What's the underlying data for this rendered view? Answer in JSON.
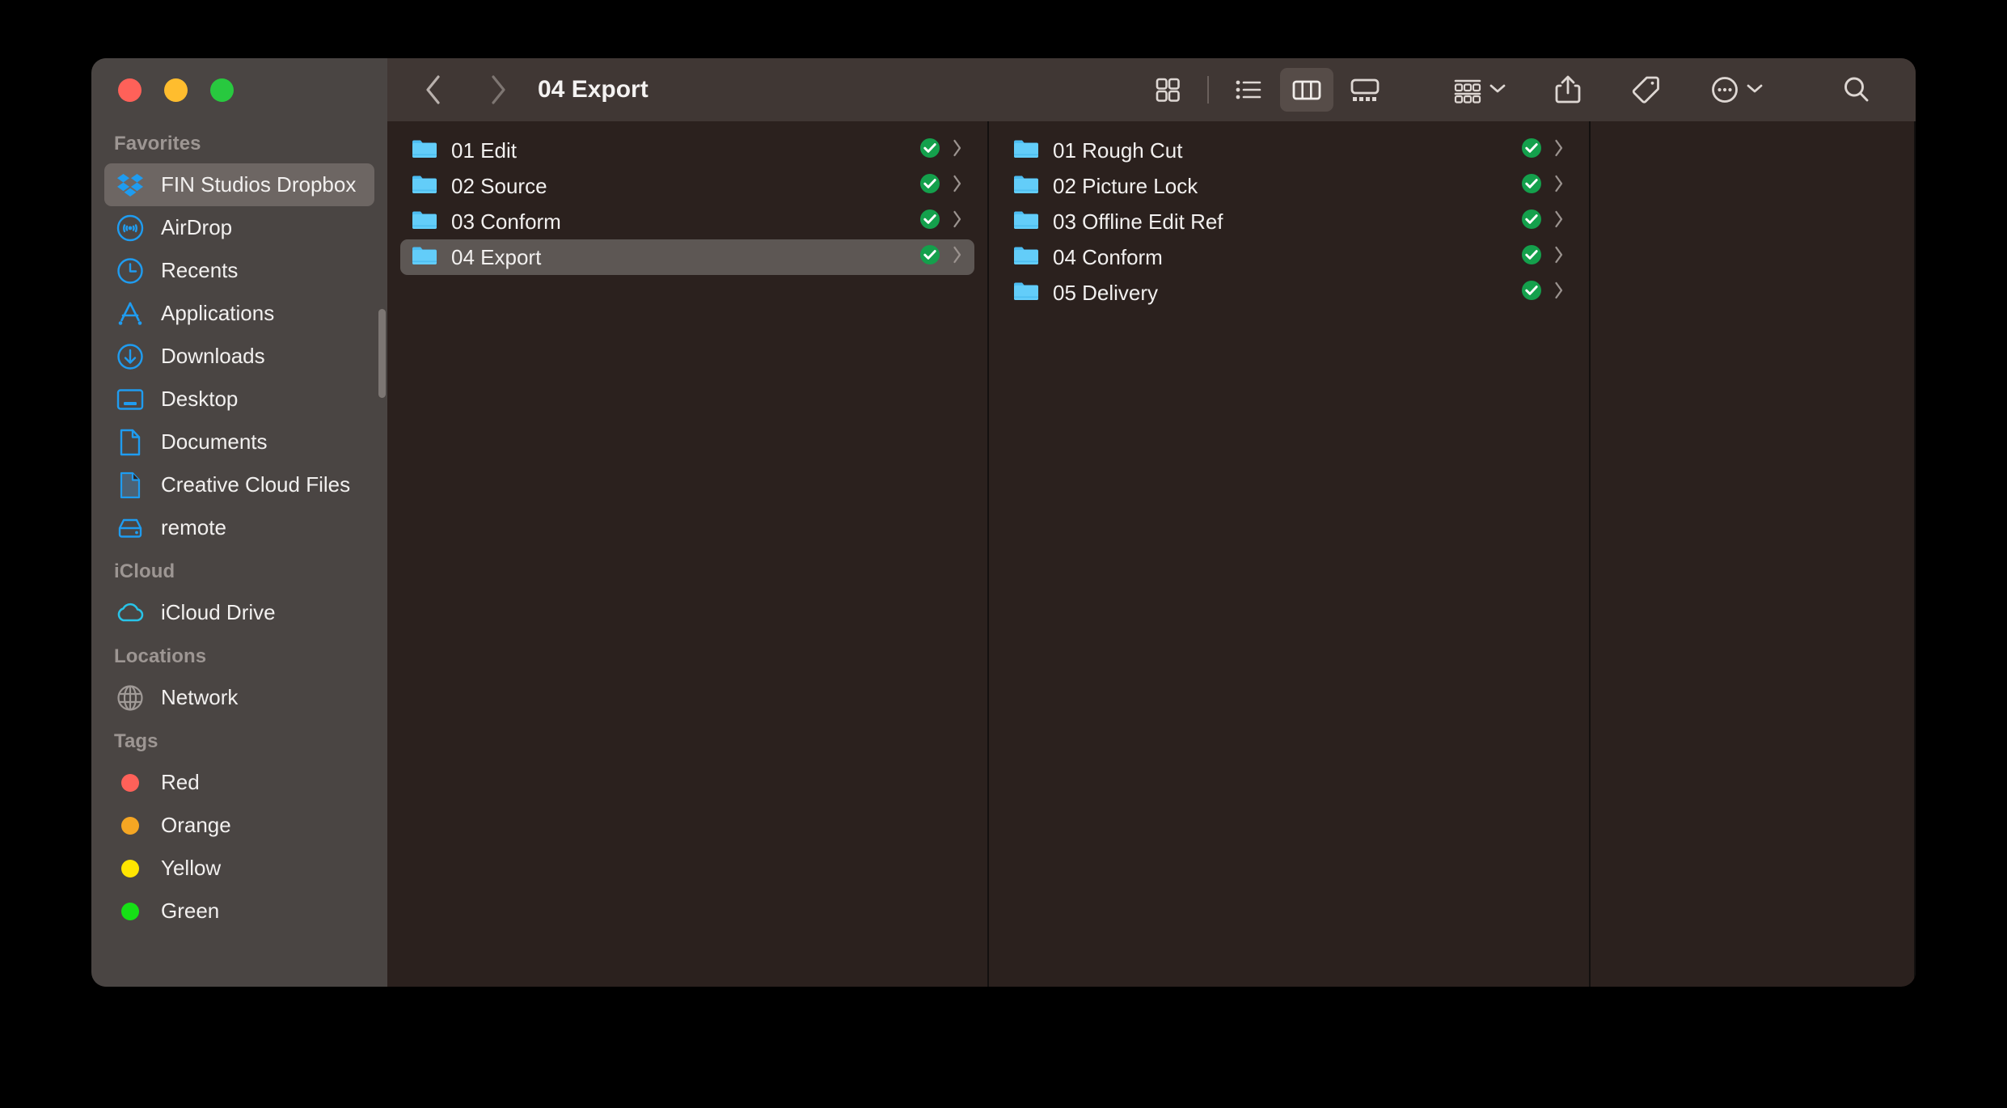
{
  "window": {
    "traffic_lights": [
      {
        "name": "close",
        "color": "#ff6159"
      },
      {
        "name": "minimize",
        "color": "#ffbd2e"
      },
      {
        "name": "zoom",
        "color": "#28c93f"
      }
    ]
  },
  "toolbar": {
    "back_label": "Back",
    "forward_label": "Forward",
    "title": "04 Export",
    "view_modes": [
      {
        "name": "icon-view",
        "label": "as Icons",
        "active": false
      },
      {
        "name": "list-view",
        "label": "as List",
        "active": false
      },
      {
        "name": "column-view",
        "label": "as Columns",
        "active": true
      },
      {
        "name": "gallery-view",
        "label": "as Gallery",
        "active": false
      }
    ],
    "actions": [
      {
        "name": "group-by",
        "label": "Group",
        "has_chevron": true
      },
      {
        "name": "share",
        "label": "Share",
        "has_chevron": false
      },
      {
        "name": "tags",
        "label": "Tags",
        "has_chevron": false
      },
      {
        "name": "more",
        "label": "More",
        "has_chevron": true
      }
    ],
    "search_label": "Search"
  },
  "sidebar": {
    "sections": [
      {
        "title": "Favorites",
        "items": [
          {
            "label": "FIN Studios Dropbox",
            "icon": "dropbox-icon",
            "selected": true
          },
          {
            "label": "AirDrop",
            "icon": "airdrop-icon",
            "selected": false
          },
          {
            "label": "Recents",
            "icon": "clock-icon",
            "selected": false
          },
          {
            "label": "Applications",
            "icon": "applications-icon",
            "selected": false
          },
          {
            "label": "Downloads",
            "icon": "downloads-icon",
            "selected": false
          },
          {
            "label": "Desktop",
            "icon": "desktop-icon",
            "selected": false
          },
          {
            "label": "Documents",
            "icon": "document-icon",
            "selected": false
          },
          {
            "label": "Creative Cloud Files",
            "icon": "creative-cloud-icon",
            "selected": false
          },
          {
            "label": "remote",
            "icon": "drive-icon",
            "selected": false
          }
        ]
      },
      {
        "title": "iCloud",
        "items": [
          {
            "label": "iCloud Drive",
            "icon": "cloud-icon",
            "selected": false
          }
        ]
      },
      {
        "title": "Locations",
        "items": [
          {
            "label": "Network",
            "icon": "globe-icon",
            "selected": false
          }
        ]
      },
      {
        "title": "Tags",
        "items": [
          {
            "label": "Red",
            "icon": "tag-dot",
            "color": "#ff6159",
            "selected": false
          },
          {
            "label": "Orange",
            "icon": "tag-dot",
            "color": "#f5a623",
            "selected": false
          },
          {
            "label": "Yellow",
            "icon": "tag-dot",
            "color": "#ffe500",
            "selected": false
          },
          {
            "label": "Green",
            "icon": "tag-dot",
            "color": "#16e016",
            "selected": false
          }
        ]
      }
    ]
  },
  "columns": [
    {
      "name": "column-1",
      "items": [
        {
          "label": "01 Edit",
          "icon": "folder-icon",
          "sync": "synced-check",
          "selected": false
        },
        {
          "label": "02 Source",
          "icon": "folder-icon",
          "sync": "synced-check",
          "selected": false
        },
        {
          "label": "03 Conform",
          "icon": "folder-icon",
          "sync": "synced-check",
          "selected": false
        },
        {
          "label": "04 Export",
          "icon": "folder-icon",
          "sync": "synced-check",
          "selected": true
        }
      ]
    },
    {
      "name": "column-2",
      "items": [
        {
          "label": "01 Rough Cut",
          "icon": "folder-icon",
          "sync": "synced-check",
          "selected": false
        },
        {
          "label": "02 Picture Lock",
          "icon": "folder-icon",
          "sync": "synced-check",
          "selected": false
        },
        {
          "label": "03 Offline Edit Ref",
          "icon": "folder-icon",
          "sync": "synced-check",
          "selected": false
        },
        {
          "label": "04 Conform",
          "icon": "folder-icon",
          "sync": "synced-check",
          "selected": false
        },
        {
          "label": "05 Delivery",
          "icon": "folder-icon",
          "sync": "synced-check",
          "selected": false
        }
      ]
    },
    {
      "name": "column-3",
      "items": []
    }
  ],
  "colors": {
    "sidebar_bg": "#4a4543",
    "toolbar_bg": "#403734",
    "content_bg": "#2b211e",
    "selection_sidebar": "#6d6663",
    "selection_row": "#5d5754",
    "accent_blue": "#1f9cf0",
    "sync_green": "#1f9e4a",
    "text_primary": "#f2f0ef",
    "text_secondary": "#9d9693"
  }
}
